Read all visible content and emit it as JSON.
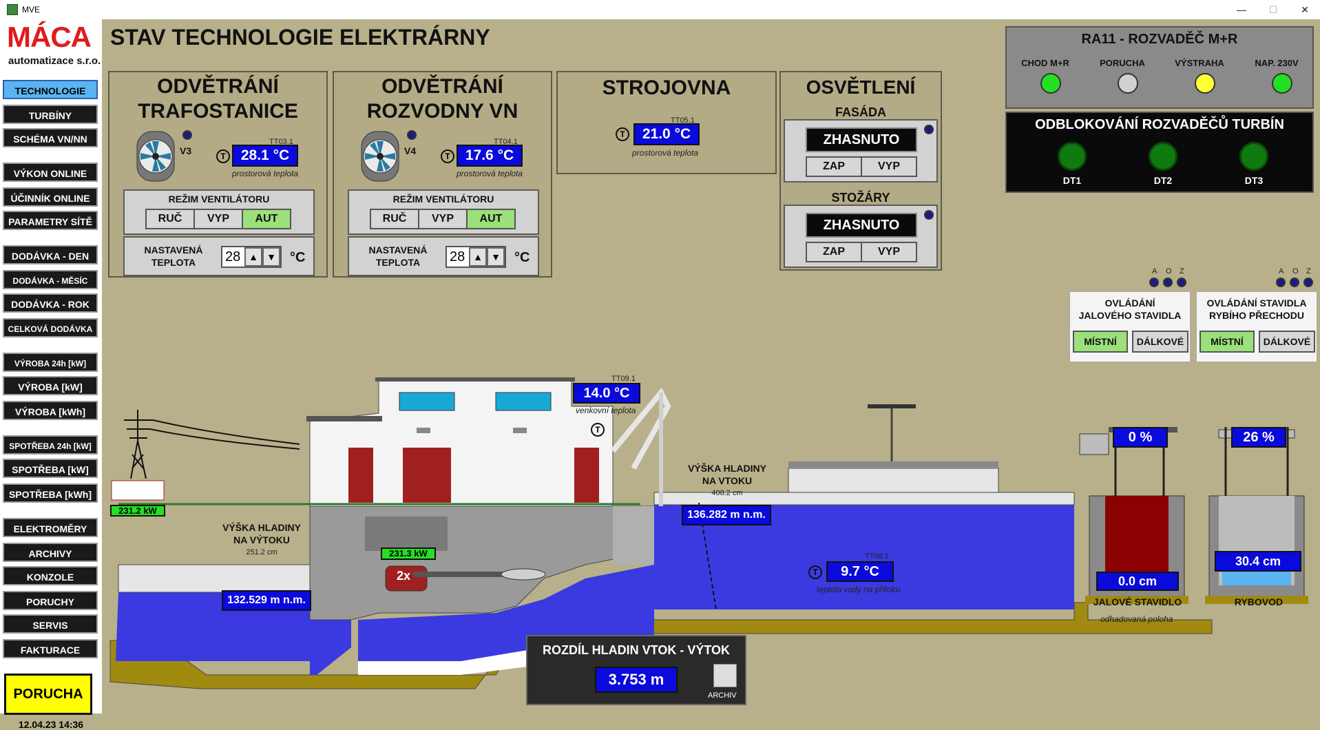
{
  "window": {
    "title": "MVE",
    "min": "—",
    "max": "☐",
    "close": "✕"
  },
  "logo": {
    "brand": "MÁCA",
    "sub": "automatizace s.r.o."
  },
  "nav": [
    "TECHNOLOGIE",
    "TURBÍNY",
    "SCHÉMA VN/NN",
    "VÝKON ONLINE",
    "ÚČINNÍK ONLINE",
    "PARAMETRY SÍTĚ",
    "DODÁVKA - DEN",
    "DODÁVKA - MĚSÍC",
    "DODÁVKA - ROK",
    "CELKOVÁ DODÁVKA",
    "VÝROBA 24h [kW]",
    "VÝROBA [kW]",
    "VÝROBA [kWh]",
    "SPOTŘEBA 24h [kW]",
    "SPOTŘEBA [kW]",
    "SPOTŘEBA [kWh]",
    "ELEKTROMĚRY",
    "ARCHIVY",
    "KONZOLE",
    "PORUCHY",
    "SERVIS",
    "FAKTURACE"
  ],
  "porucha": "PORUCHA",
  "datetime": "12.04.23 14:36",
  "pageTitle": "STAV TECHNOLOGIE ELEKTRÁRNY",
  "vent1": {
    "title1": "ODVĚTRÁNÍ",
    "title2": "TRAFOSTANICE",
    "fan": "V3",
    "tag": "TT03.1",
    "value": "28.1 °C",
    "desc": "prostorová teplota",
    "mode_label": "REŽIM VENTILÁTORU",
    "ruc": "RUČ",
    "vyp": "VYP",
    "aut": "AUT",
    "set_label1": "NASTAVENÁ",
    "set_label2": "TEPLOTA",
    "set": "28",
    "unit": "°C"
  },
  "vent2": {
    "title1": "ODVĚTRÁNÍ",
    "title2": "ROZVODNY VN",
    "fan": "V4",
    "tag": "TT04.1",
    "value": "17.6 °C",
    "desc": "prostorová teplota",
    "mode_label": "REŽIM VENTILÁTORU",
    "ruc": "RUČ",
    "vyp": "VYP",
    "aut": "AUT",
    "set_label1": "NASTAVENÁ",
    "set_label2": "TEPLOTA",
    "set": "28",
    "unit": "°C"
  },
  "strojovna": {
    "title": "STROJOVNA",
    "tag": "TT05.1",
    "value": "21.0 °C",
    "desc": "prostorová teplota"
  },
  "osvetleni": {
    "title": "OSVĚTLENÍ",
    "fasada": "FASÁDA",
    "fasada_state": "ZHASNUTO",
    "stozary": "STOŽÁRY",
    "stozary_state": "ZHASNUTO",
    "zap": "ZAP",
    "vyp": "VYP"
  },
  "ra11": {
    "title": "RA11 - ROZVADĚČ M+R",
    "lamps": [
      {
        "label": "CHOD M+R",
        "color": "#22e022"
      },
      {
        "label": "PORUCHA",
        "color": "#d0d0d0"
      },
      {
        "label": "VÝSTRAHA",
        "color": "#ffff33"
      },
      {
        "label": "NAP. 230V",
        "color": "#22e022"
      }
    ]
  },
  "odblok": {
    "title": "ODBLOKOVÁNÍ ROZVADĚČŮ TURBÍN",
    "items": [
      "DT1",
      "DT2",
      "DT3"
    ]
  },
  "stavidla": [
    {
      "title1": "OVLÁDÁNÍ",
      "title2": "JALOVÉHO STAVIDLA",
      "mistni": "MÍSTNÍ",
      "dalkove": "DÁLKOVÉ",
      "aoz": [
        "A",
        "O",
        "Z"
      ]
    },
    {
      "title1": "OVLÁDÁNÍ STAVIDLA",
      "title2": "RYBÍHO PŘECHODU",
      "mistni": "MÍSTNÍ",
      "dalkove": "DÁLKOVÉ",
      "aoz": [
        "A",
        "O",
        "Z"
      ]
    }
  ],
  "scene": {
    "grid_power": "231.2 kW",
    "gen_power": "231.3 kW",
    "gen_label": "2x",
    "outdoor": {
      "tag": "TT09.1",
      "value": "14.0 °C",
      "desc": "venkovní teplota"
    },
    "vytok": {
      "label1": "VÝŠKA HLADINY",
      "label2": "NA VÝTOKU",
      "cm": "251.2 cm",
      "value": "132.529 m n.m."
    },
    "vtok": {
      "label1": "VÝŠKA HLADINY",
      "label2": "NA VTOKU",
      "cm": "408.2 cm",
      "value": "136.282 m n.m."
    },
    "water": {
      "tag": "TT08.1",
      "value": "9.7 °C",
      "desc": "teplota vody na přítoku"
    },
    "jalove": {
      "pct": "0 %",
      "cm": "0.0 cm",
      "label": "JALOVÉ STAVIDLO",
      "desc": "odhadovaná poloha"
    },
    "rybovod": {
      "pct": "26 %",
      "cm": "30.4 cm",
      "label": "RYBOVOD"
    }
  },
  "diff": {
    "title": "ROZDÍL HLADIN VTOK - VÝTOK",
    "value": "3.753 m",
    "archiv": "ARCHIV"
  },
  "colors": {
    "water": "#3a3ae0",
    "panel": "#b3ab86",
    "alarm": "#ffff00"
  }
}
